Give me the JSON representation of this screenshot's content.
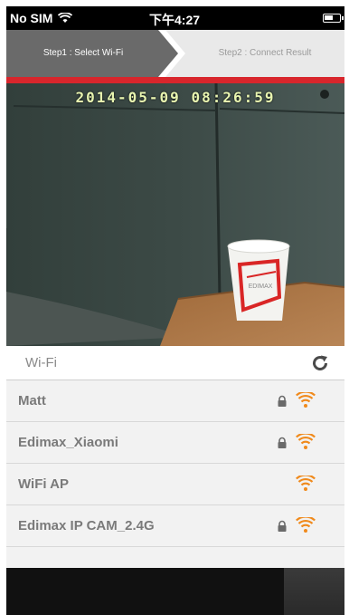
{
  "status_bar": {
    "carrier": "No SIM",
    "time": "下午4:27"
  },
  "steps": {
    "step1": "Step1 : Select Wi-Fi",
    "step2": "Step2 : Connect Result"
  },
  "camera": {
    "timestamp": "2014-05-09  08:26:59"
  },
  "wifi_list": {
    "title": "Wi-Fi",
    "networks": [
      {
        "name": "Matt",
        "locked": true
      },
      {
        "name": "Edimax_Xiaomi",
        "locked": true
      },
      {
        "name": "WiFi AP",
        "locked": false
      },
      {
        "name": "Edimax IP CAM_2.4G",
        "locked": true
      }
    ]
  },
  "colors": {
    "accent_red": "#d8262c",
    "wifi_orange": "#f08a1c",
    "step_active": "#6a6a6a"
  },
  "icons": [
    "wifi-icon",
    "battery-icon",
    "refresh-icon",
    "lock-icon",
    "wifi-signal-icon"
  ]
}
